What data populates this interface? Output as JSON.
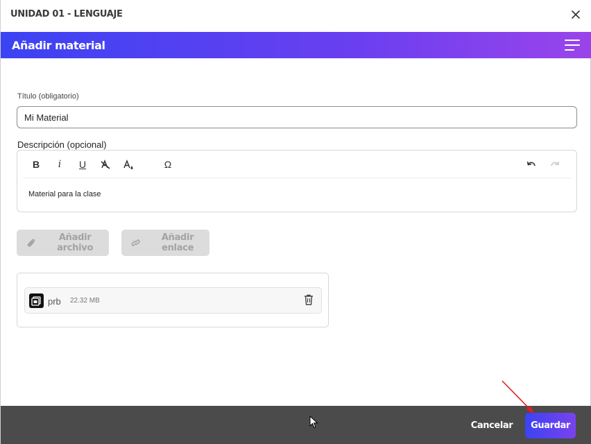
{
  "window": {
    "title": "UNIDAD 01 - LENGUAJE"
  },
  "banner": {
    "title": "Añadir material"
  },
  "form": {
    "title_label": "Título (obligatorio)",
    "title_value": "Mi Material",
    "description_label": "Descripción (opcional)",
    "description_text": "Material para la clase"
  },
  "toolbar": {
    "bold": "B",
    "italic": "i",
    "underline": "U",
    "special_char": "Ω"
  },
  "buttons": {
    "add_file": "Añadir archivo",
    "add_link": "Añadir enlace",
    "cancel": "Cancelar",
    "save": "Guardar"
  },
  "attachments": [
    {
      "name": "prb",
      "size": "22.32 MB"
    }
  ],
  "colors": {
    "accent_start": "#3b43f3",
    "accent_end": "#9a44ea",
    "footer": "#4b4b4b",
    "disabled_button": "#dcdcdc",
    "annotation_arrow": "#e02020"
  },
  "icons": {
    "close": "close-icon",
    "menu": "hamburger-menu-icon",
    "clear_format": "clear-format-icon",
    "fill_color": "fill-color-icon",
    "undo": "undo-icon",
    "redo": "redo-icon",
    "paperclip": "paperclip-icon",
    "link": "link-icon",
    "file": "file-icon",
    "trash": "trash-icon"
  }
}
